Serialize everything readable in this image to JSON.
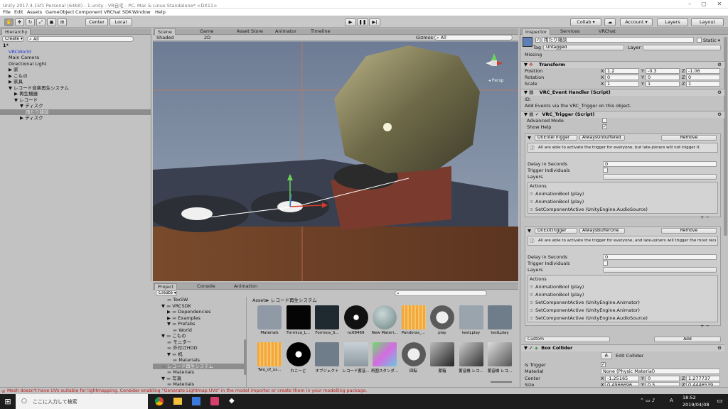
{
  "window": {
    "title": "Unity 2017.4.15f1 Personal (64bit) - 1.unity - VR自宅 - PC, Mac & Linux Standalone* <DX11>",
    "min": "–",
    "max": "▢",
    "close": "✕"
  },
  "menu": [
    "File",
    "Edit",
    "Assets",
    "GameObject",
    "Component",
    "VRChat SDK",
    "Window",
    "Help"
  ],
  "toolbar": {
    "center": "Center",
    "local": "Local",
    "collab": "Collab ▾",
    "account": "Account ▾",
    "layers": "Layers",
    "layout": "Layout"
  },
  "hierarchy": {
    "tab": "Hierarchy",
    "create": "Create ▾",
    "search": "All",
    "items": [
      {
        "label": "1*",
        "indent": 0,
        "bold": true
      },
      {
        "label": "VRCWorld",
        "indent": 1,
        "blue": true
      },
      {
        "label": "Main Camera",
        "indent": 1
      },
      {
        "label": "Directional Light",
        "indent": 1
      },
      {
        "label": "家",
        "indent": 1,
        "arrow": "▶"
      },
      {
        "label": "こもの",
        "indent": 1,
        "arrow": "▶"
      },
      {
        "label": "家具",
        "indent": 1,
        "arrow": "▶"
      },
      {
        "label": "レコード音楽再生システム",
        "indent": 1,
        "arrow": "▼"
      },
      {
        "label": "再生機器",
        "indent": 2,
        "arrow": "▶"
      },
      {
        "label": "レコード",
        "indent": 2,
        "arrow": "▼"
      },
      {
        "label": "ディスク",
        "indent": 3,
        "arrow": "▼"
      },
      {
        "label": "雨たり雑談",
        "indent": 4,
        "selected": true
      },
      {
        "label": "ディスク",
        "indent": 3,
        "arrow": "▶"
      }
    ]
  },
  "scene": {
    "tabs": [
      "Scene",
      "Game",
      "Asset Store",
      "Animator",
      "Timeline"
    ],
    "shaded": "Shaded",
    "mode": "2D",
    "gizmos": "Gizmos ▾",
    "search": "All",
    "persp": "◂ Persp"
  },
  "project": {
    "tabs": [
      "Project",
      "Console",
      "Animation"
    ],
    "create": "Create ▾",
    "breadcrumb": [
      "Assets",
      "レコード再生システム"
    ],
    "tree": [
      {
        "label": "TexSW",
        "indent": 2
      },
      {
        "label": "VRCSDK",
        "indent": 1,
        "arrow": "▼"
      },
      {
        "label": "Dependencies",
        "indent": 2,
        "arrow": "▶"
      },
      {
        "label": "Examples",
        "indent": 2,
        "arrow": "▶"
      },
      {
        "label": "Prefabs",
        "indent": 2,
        "arrow": "▼"
      },
      {
        "label": "World",
        "indent": 3
      },
      {
        "label": "こもの",
        "indent": 1,
        "arrow": "▼"
      },
      {
        "label": "モニター",
        "indent": 2
      },
      {
        "label": "外付けHDD",
        "indent": 2
      },
      {
        "label": "机",
        "indent": 2,
        "arrow": "▼"
      },
      {
        "label": "Materials",
        "indent": 3
      },
      {
        "label": "レコード再生システム",
        "indent": 1,
        "selected": true
      },
      {
        "label": "Materials",
        "indent": 2
      },
      {
        "label": "写真",
        "indent": 1,
        "arrow": "▼"
      },
      {
        "label": "Materials",
        "indent": 2
      }
    ],
    "assets": [
      {
        "label": "Materials",
        "kind": "folder"
      },
      {
        "label": "Formica_L...",
        "kind": "black"
      },
      {
        "label": "Formica_S...",
        "kind": "dark"
      },
      {
        "label": "nc68469",
        "kind": "disc"
      },
      {
        "label": "New Materi...",
        "kind": "sphere"
      },
      {
        "label": "Pandoras_...",
        "kind": "wave"
      },
      {
        "label": "play",
        "kind": "play"
      },
      {
        "label": "testLplay",
        "kind": "gear"
      },
      {
        "label": "testLplay",
        "kind": "anim"
      },
      {
        "label": "Two_of_us...",
        "kind": "wave"
      },
      {
        "label": "れこーど",
        "kind": "vinyl"
      },
      {
        "label": "オブジェクト",
        "kind": "anim"
      },
      {
        "label": "レコード蓄音...",
        "kind": "gram"
      },
      {
        "label": "再圏スタンダ...",
        "kind": "shader"
      },
      {
        "label": "回転",
        "kind": "play"
      },
      {
        "label": "蓄箱",
        "kind": "box"
      },
      {
        "label": "蓄音機 レコ...",
        "kind": "gram2"
      },
      {
        "label": "蓄音機 レコ...",
        "kind": "gram3"
      }
    ]
  },
  "inspector": {
    "tabs": [
      "Inspector",
      "Services",
      "VRChat"
    ],
    "name": "雨たり雑談",
    "static": "Static ▾",
    "tag_label": "Tag",
    "tag": "Untagged",
    "layer_label": "Layer",
    "layer": "",
    "missing": "Missing",
    "transform": {
      "title": "Transform",
      "position_label": "Position",
      "rotation_label": "Rotation",
      "scale_label": "Scale",
      "position": [
        "1.2",
        "-0.3",
        "-1.06"
      ],
      "rotation": [
        "0",
        "0",
        "0"
      ],
      "scale": [
        "1",
        "1",
        "1"
      ]
    },
    "event_handler": {
      "title": "VRC_Event Handler (Script)",
      "id_label": "ID:",
      "note": "Add Events via the VRC_Trigger on this object."
    },
    "trigger": {
      "title": "VRC_Trigger (Script)",
      "advanced_mode": "Advanced Mode",
      "show_help": "Show Help",
      "blocks": [
        {
          "type": "OnEnterTrigger",
          "buffer": "AlwaysUnbuffered",
          "remove": "Remove",
          "info": "All are able to activate the trigger for everyone, but late-joiners will not trigger it.",
          "delay_label": "Delay in Seconds",
          "delay": "0",
          "individuals": "Trigger Individuals",
          "layers": "Layers",
          "actions_label": "Actions",
          "actions": [
            "AnimationBool (play)",
            "AnimationBool (play)",
            "SetComponentActive (UnityEngine.AudioSource)"
          ]
        },
        {
          "type": "OnExitTrigger",
          "buffer": "AlwaysBufferOne",
          "remove": "Remove",
          "info": "All are able to activate the trigger for everyone, and late-joiners will trigger the most recent one.",
          "delay_label": "Delay in Seconds",
          "delay": "0",
          "individuals": "Trigger Individuals",
          "layers": "Layers",
          "actions_label": "Actions",
          "actions": [
            "AnimationBool (play)",
            "AnimationBool (play)",
            "SetComponentActive (UnityEngine.Animator)",
            "SetComponentActive (UnityEngine.Animator)",
            "SetComponentActive (UnityEngine.AudioSource)"
          ]
        }
      ],
      "custom": "Custom",
      "add": "Add"
    },
    "box_collider": {
      "title": "Box Collider",
      "edit": "Edit Collider",
      "is_trigger": "Is Trigger",
      "material_label": "Material",
      "material": "None (Physic Material)",
      "center_label": "Center",
      "center": [
        "-1.25165",
        "0",
        "1.277737"
      ],
      "size_label": "Size",
      "size": [
        "0.4966696",
        "0.5",
        "0.4446539"
      ]
    }
  },
  "status": "Mesh doesn't have UVs suitable for lightmapping. Consider enabling \"Generate Lightmap UVs\" in the model importer or create them in your modelling package.",
  "taskbar": {
    "search": "ここに入力して検索",
    "time": "18:52",
    "date": "2019/04/08",
    "ime": "A"
  },
  "colors": {
    "panel": "#c2c2c2",
    "header": "#a9a9a9",
    "selected": "#8d8d8d",
    "blue": "#1f3bd2",
    "error": "#c21b1b"
  }
}
